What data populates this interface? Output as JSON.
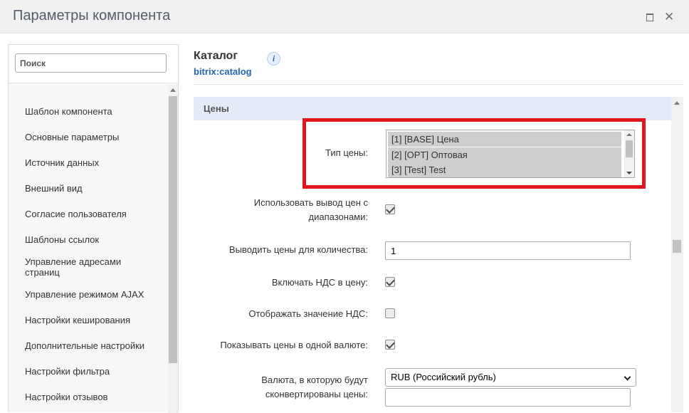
{
  "window": {
    "title": "Параметры компонента",
    "maximize_icon": "maximize-icon",
    "close_icon": "close-icon",
    "close_glyph": "✕"
  },
  "sidebar": {
    "search_placeholder": "Поиск",
    "items": [
      {
        "label": "Шаблон компонента"
      },
      {
        "label": "Основные параметры"
      },
      {
        "label": "Источник данных"
      },
      {
        "label": "Внешний вид"
      },
      {
        "label": "Согласие пользователя"
      },
      {
        "label": "Шаблоны ссылок"
      },
      {
        "label": "Управление адресами страниц"
      },
      {
        "label": "Управление режимом AJAX"
      },
      {
        "label": "Настройки кеширования"
      },
      {
        "label": "Дополнительные настройки"
      },
      {
        "label": "Настройки фильтра"
      },
      {
        "label": "Настройки отзывов"
      }
    ]
  },
  "component": {
    "title": "Каталог",
    "code": "bitrix:catalog",
    "info_glyph": "i"
  },
  "section": {
    "title": "Цены"
  },
  "fields": {
    "price_type": {
      "label": "Тип цены:",
      "options": [
        "[1] [BASE] Цена",
        "[2] [OPT] Оптовая",
        "[3] [Test] Test"
      ]
    },
    "use_price_ranges": {
      "label": "Использовать вывод цен с диапазонами:",
      "checked": true
    },
    "price_for_quantity": {
      "label": "Выводить цены для количества:",
      "value": "1"
    },
    "include_vat": {
      "label": "Включать НДС в цену:",
      "checked": true
    },
    "show_vat_value": {
      "label": "Отображать значение НДС:",
      "checked": false
    },
    "single_currency": {
      "label": "Показывать цены в одной валюте:",
      "checked": true
    },
    "currency": {
      "label": "Валюта, в которую будут сконвертированы цены:",
      "selected": "RUB (Российский рубль)"
    }
  },
  "colors": {
    "highlight": "#e3161e",
    "link": "#2067b0",
    "section_bg": "#e3ecf6"
  }
}
